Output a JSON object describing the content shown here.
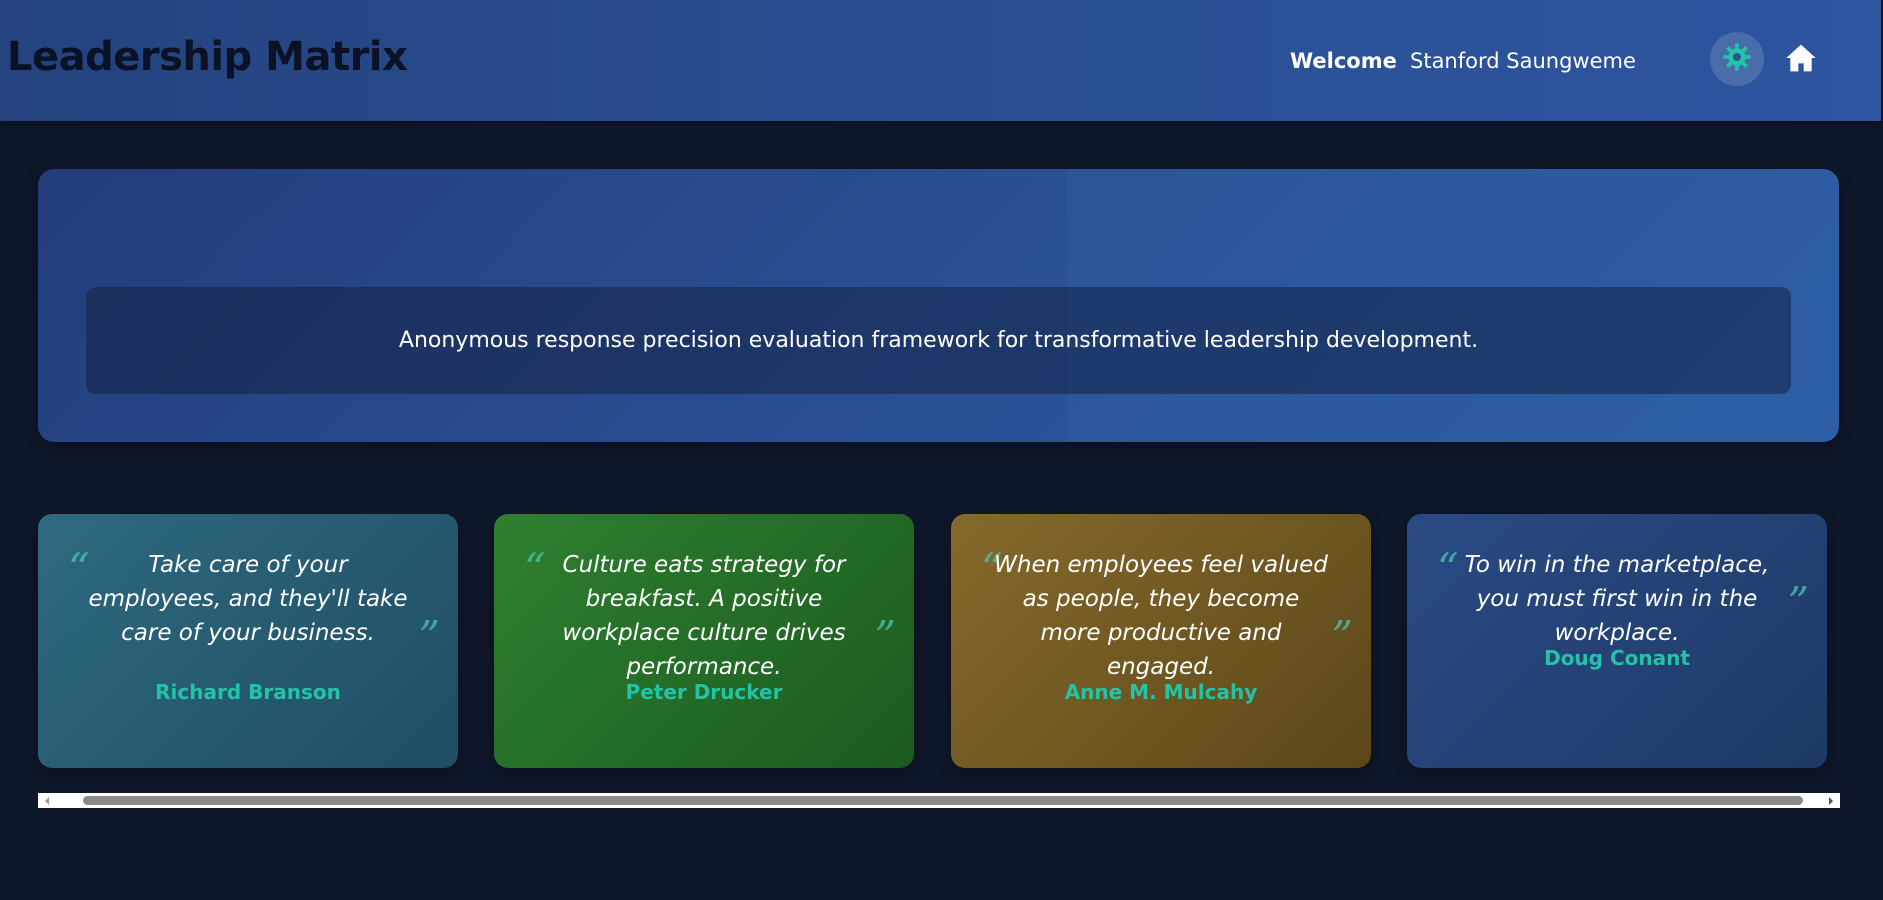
{
  "header": {
    "title": "Leadership Matrix",
    "welcome_label": "Welcome",
    "username": "Stanford Saungweme",
    "theme_toggle_icon": "gear-icon",
    "home_icon": "home-icon"
  },
  "hero": {
    "tagline": "Anonymous response precision evaluation framework for transformative leadership development."
  },
  "quotes": [
    {
      "text": "Take care of your employees, and they'll take care of your business.",
      "author": "Richard Branson",
      "color": "#2e6a80"
    },
    {
      "text": "Culture eats strategy for breakfast. A positive workplace culture drives performance.",
      "author": "Peter Drucker",
      "color": "#2e8030"
    },
    {
      "text": "When employees feel valued as people, they become more productive and engaged.",
      "author": "Anne M. Mulcahy",
      "color": "#866a2c"
    },
    {
      "text": "To win in the marketplace, you must first win in the workplace.",
      "author": "Doug Conant",
      "color": "#2a4a85"
    }
  ],
  "colors": {
    "background": "#0f172a",
    "header": "#2a4f94",
    "accent": "#22c4a8"
  },
  "scrollbar": {
    "left_arrow_icon": "chevron-left-icon",
    "right_arrow_icon": "chevron-right-icon"
  }
}
